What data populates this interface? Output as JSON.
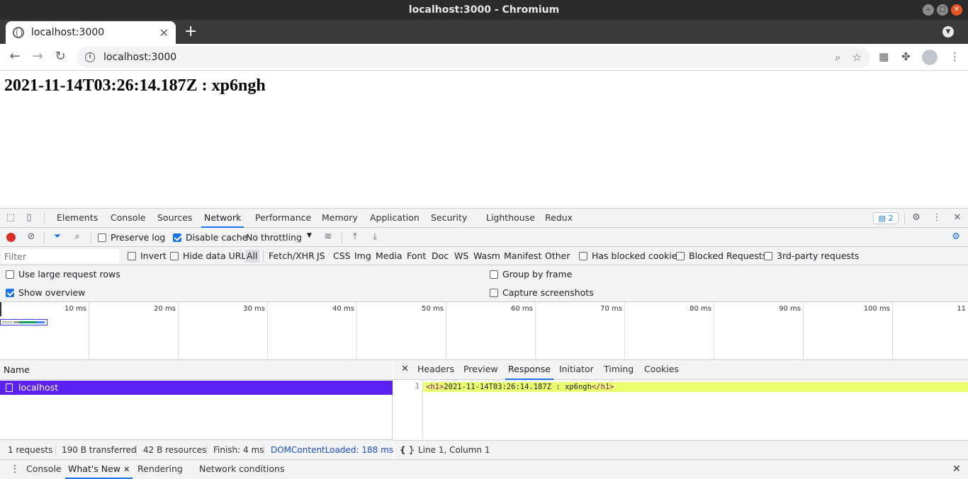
{
  "window": {
    "title": "localhost:3000 - Chromium"
  },
  "browser": {
    "tab_title": "localhost:3000",
    "url": "localhost:3000"
  },
  "page": {
    "heading": "2021-11-14T03:26:14.187Z : xp6ngh"
  },
  "devtools": {
    "tabs": [
      "Elements",
      "Console",
      "Sources",
      "Network",
      "Performance",
      "Memory",
      "Application",
      "Security",
      "Lighthouse",
      "Redux"
    ],
    "active_tab": "Network",
    "issues_count": "2",
    "toolbar": {
      "preserve_log": "Preserve log",
      "disable_cache": "Disable cache",
      "throttling": "No throttling"
    },
    "filter": {
      "placeholder": "Filter",
      "invert": "Invert",
      "hide_data_urls": "Hide data URLs",
      "types": [
        "All",
        "Fetch/XHR",
        "JS",
        "CSS",
        "Img",
        "Media",
        "Font",
        "Doc",
        "WS",
        "Wasm",
        "Manifest",
        "Other"
      ],
      "has_blocked_cookies": "Has blocked cookies",
      "blocked_requests": "Blocked Requests",
      "third_party": "3rd-party requests"
    },
    "settings": {
      "large_rows": "Use large request rows",
      "show_overview": "Show overview",
      "group_by_frame": "Group by frame",
      "capture_screenshots": "Capture screenshots"
    },
    "overview_ticks": [
      "10 ms",
      "20 ms",
      "30 ms",
      "40 ms",
      "50 ms",
      "60 ms",
      "70 ms",
      "80 ms",
      "90 ms",
      "100 ms",
      "11"
    ],
    "name_header": "Name",
    "request": "localhost",
    "detail_tabs": [
      "Headers",
      "Preview",
      "Response",
      "Initiator",
      "Timing",
      "Cookies"
    ],
    "active_detail_tab": "Response",
    "response": {
      "line_number": "1",
      "open_tag": "<h1>",
      "text": "2021-11-14T03:26:14.187Z : xp6ngh",
      "close_tag": "</h1>",
      "position": "Line 1, Column 1"
    },
    "status": {
      "requests": "1 requests",
      "transferred": "190 B transferred",
      "resources": "42 B resources",
      "finish": "Finish: 4 ms",
      "dom_loaded": "DOMContentLoaded: 188 ms"
    },
    "drawer_tabs": [
      "Console",
      "What's New",
      "Rendering",
      "Network conditions"
    ],
    "active_drawer_tab": "What's New"
  },
  "colors": {
    "selected_row": "#5b21f2",
    "accent": "#1a73e8",
    "record": "#d93025",
    "highlight_line": "#ecff6f"
  }
}
